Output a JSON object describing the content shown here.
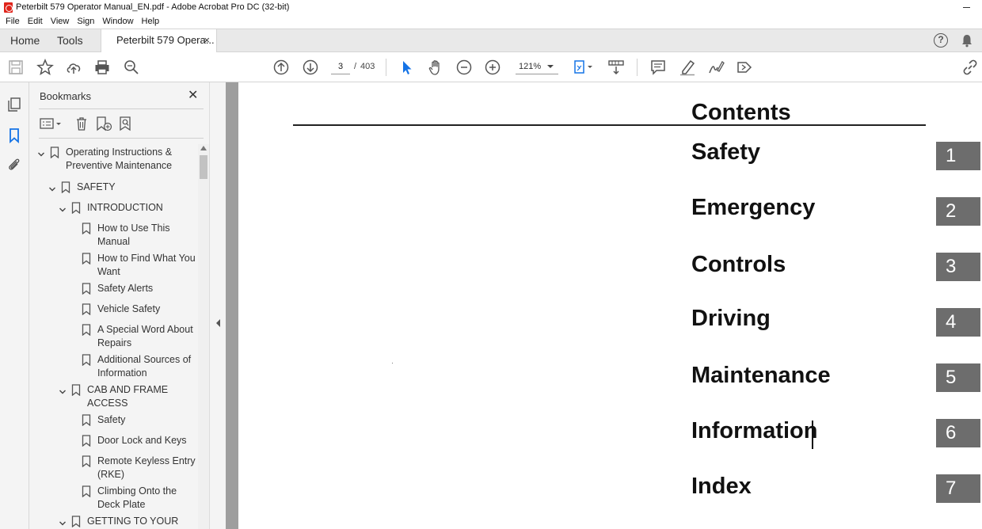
{
  "window": {
    "title": "Peterbilt 579 Operator Manual_EN.pdf - Adobe Acrobat Pro DC (32-bit)"
  },
  "menu": [
    "File",
    "Edit",
    "View",
    "Sign",
    "Window",
    "Help"
  ],
  "tabs": {
    "home": "Home",
    "tools": "Tools",
    "document": "Peterbilt 579 Opera...",
    "close": "×"
  },
  "toolbar": {
    "page_current": "3",
    "page_sep": "/",
    "page_total": "403",
    "zoom": "121%"
  },
  "bookmarks": {
    "title": "Bookmarks",
    "close": "✕",
    "items": [
      {
        "label_lines": [
          "Operating Instructions &",
          "Preventive Maintenance"
        ],
        "level": 0,
        "expanded": true
      },
      {
        "label_lines": [
          "SAFETY"
        ],
        "level": 1,
        "expanded": true
      },
      {
        "label_lines": [
          "INTRODUCTION"
        ],
        "level": 2,
        "expanded": true
      },
      {
        "label_lines": [
          "How to Use This",
          "Manual"
        ],
        "level": 3
      },
      {
        "label_lines": [
          "How to Find What You",
          "Want"
        ],
        "level": 3
      },
      {
        "label_lines": [
          "Safety Alerts"
        ],
        "level": 3
      },
      {
        "label_lines": [
          "Vehicle Safety"
        ],
        "level": 3
      },
      {
        "label_lines": [
          "A Special Word About",
          "Repairs"
        ],
        "level": 3
      },
      {
        "label_lines": [
          "Additional Sources of",
          "Information"
        ],
        "level": 3
      },
      {
        "label_lines": [
          "CAB AND FRAME",
          "ACCESS"
        ],
        "level": 2,
        "expanded": true
      },
      {
        "label_lines": [
          "Safety"
        ],
        "level": 3
      },
      {
        "label_lines": [
          "Door Lock and Keys"
        ],
        "level": 3
      },
      {
        "label_lines": [
          "Remote Keyless Entry",
          "(RKE)"
        ],
        "level": 3
      },
      {
        "label_lines": [
          "Climbing Onto the",
          "Deck Plate"
        ],
        "level": 3
      },
      {
        "label_lines": [
          "GETTING TO YOUR"
        ],
        "level": 2,
        "expanded": true
      }
    ]
  },
  "document": {
    "heading": "Contents",
    "toc": [
      {
        "label": "Safety",
        "number": "1"
      },
      {
        "label": "Emergency",
        "number": "2"
      },
      {
        "label": "Controls",
        "number": "3"
      },
      {
        "label": "Driving",
        "number": "4"
      },
      {
        "label": "Maintenance",
        "number": "5"
      },
      {
        "label": "Information",
        "number": "6"
      },
      {
        "label": "Index",
        "number": "7"
      }
    ]
  },
  "colors": {
    "toc_box": "#6d6d6d",
    "accent_blue": "#1473e6",
    "pdf_red": "#e0241b"
  }
}
